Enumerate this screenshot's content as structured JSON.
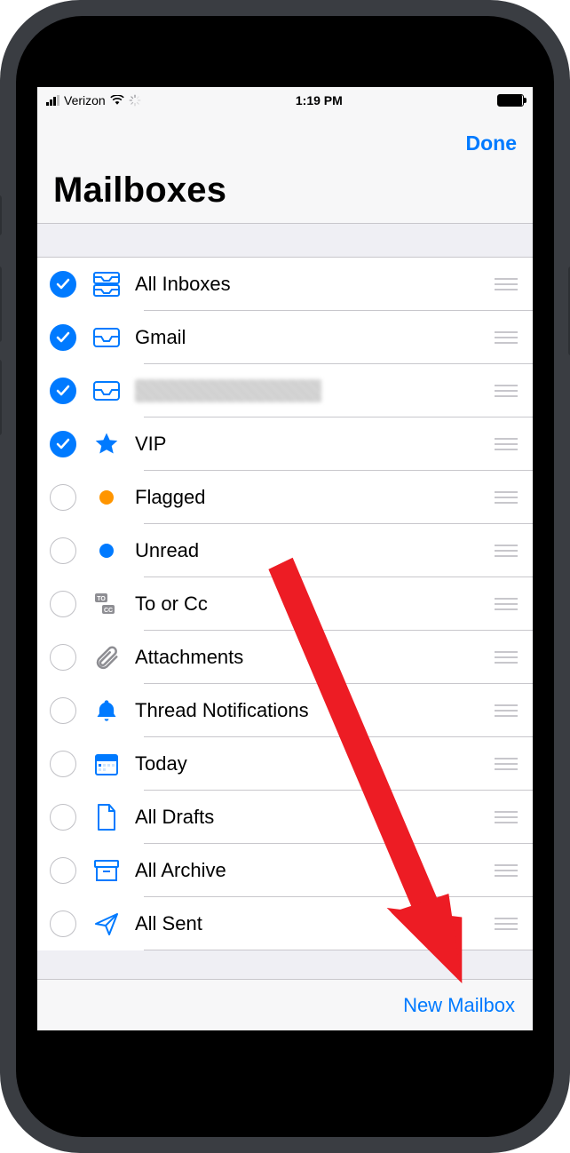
{
  "status": {
    "carrier": "Verizon",
    "time": "1:19 PM"
  },
  "nav": {
    "done": "Done",
    "title": "Mailboxes"
  },
  "rows": [
    {
      "label": "All Inboxes",
      "checked": true,
      "icon": "all-inboxes"
    },
    {
      "label": "Gmail",
      "checked": true,
      "icon": "inbox"
    },
    {
      "label": "",
      "checked": true,
      "icon": "inbox",
      "redacted": true
    },
    {
      "label": "VIP",
      "checked": true,
      "icon": "star"
    },
    {
      "label": "Flagged",
      "checked": false,
      "icon": "flag-dot"
    },
    {
      "label": "Unread",
      "checked": false,
      "icon": "unread-dot"
    },
    {
      "label": "To or Cc",
      "checked": false,
      "icon": "tocc"
    },
    {
      "label": "Attachments",
      "checked": false,
      "icon": "clip"
    },
    {
      "label": "Thread Notifications",
      "checked": false,
      "icon": "bell"
    },
    {
      "label": "Today",
      "checked": false,
      "icon": "calendar"
    },
    {
      "label": "All Drafts",
      "checked": false,
      "icon": "draft"
    },
    {
      "label": "All Archive",
      "checked": false,
      "icon": "archive"
    },
    {
      "label": "All Sent",
      "checked": false,
      "icon": "send"
    }
  ],
  "toolbar": {
    "new_mailbox": "New Mailbox"
  }
}
